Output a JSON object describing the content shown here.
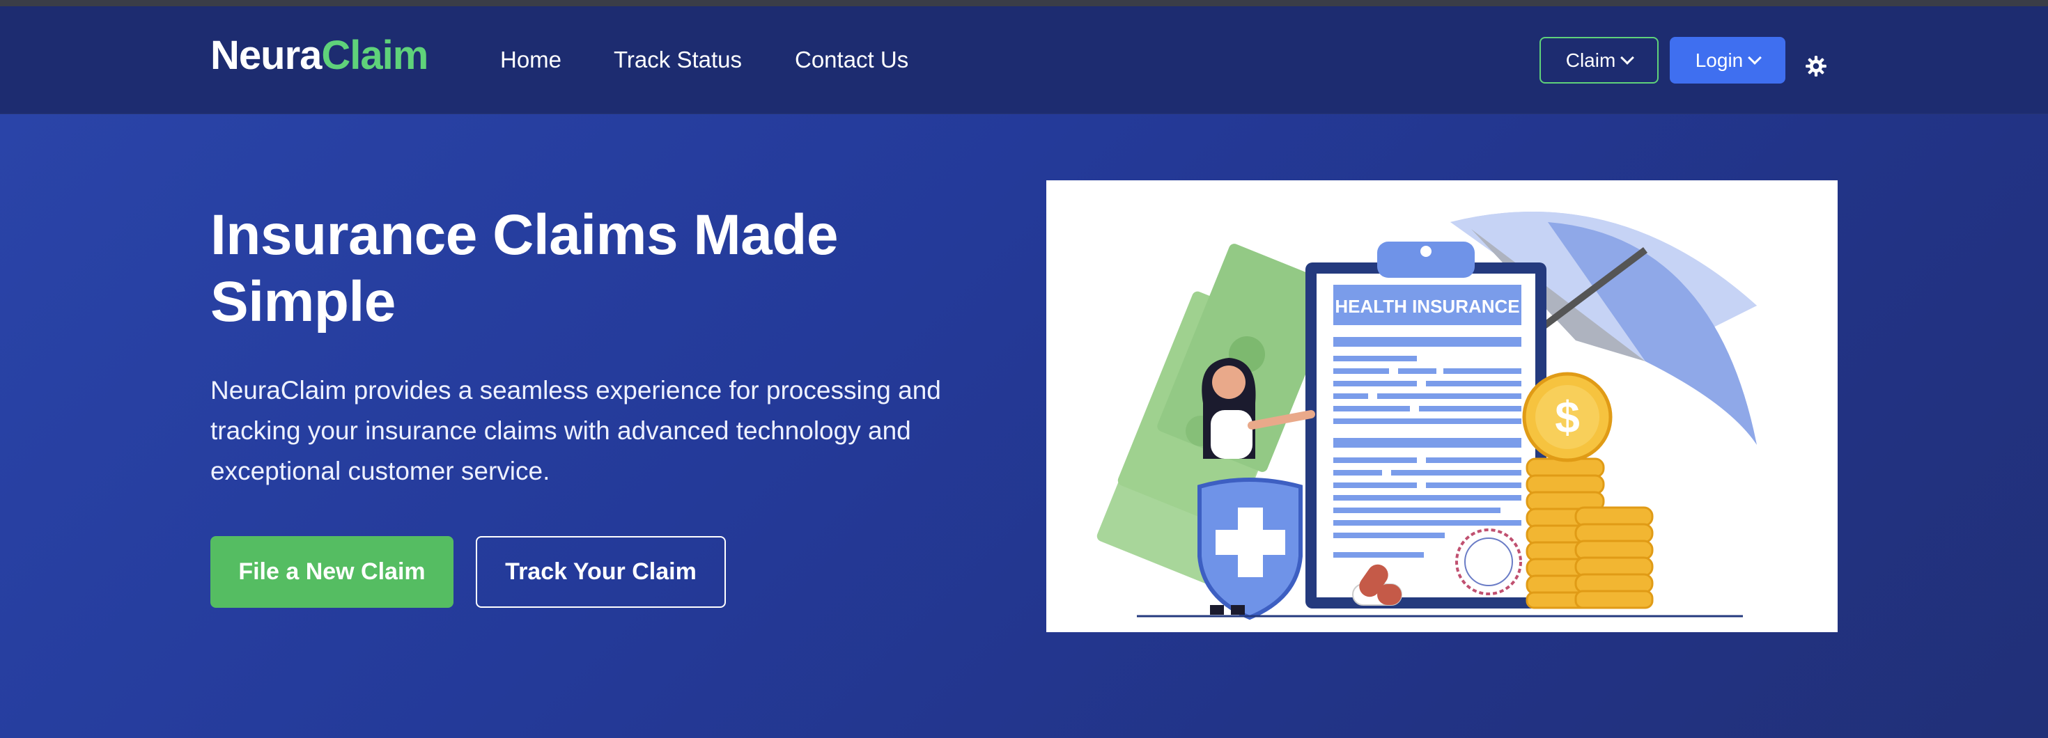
{
  "brand": {
    "part1": "Neura",
    "part2": "Claim"
  },
  "nav": {
    "links": [
      "Home",
      "Track Status",
      "Contact Us"
    ],
    "claim_label": "Claim",
    "login_label": "Login",
    "theme_icon": "gear-icon"
  },
  "hero": {
    "title": "Insurance Claims Made Simple",
    "text": "NeuraClaim provides a seamless experience for processing and tracking your insurance claims with advanced technology and exceptional customer service.",
    "primary_button": "File a New Claim",
    "secondary_button": "Track Your Claim",
    "illustration": {
      "document_title": "HEALTH INSURANCE"
    }
  },
  "colors": {
    "brand_accent": "#5fd27a",
    "nav_bg": "#1d2c70",
    "hero_bg": "#243a99",
    "primary_button": "#55bd62",
    "login_button": "#3f6ff0"
  }
}
